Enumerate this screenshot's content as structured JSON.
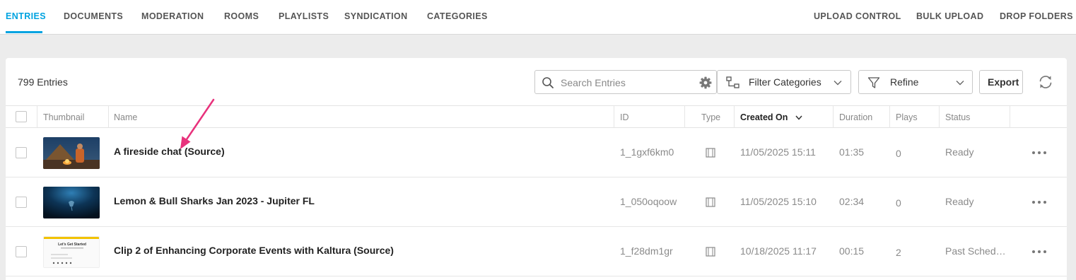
{
  "nav": {
    "tabs_left": [
      "ENTRIES",
      "DOCUMENTS",
      "MODERATION",
      "ROOMS",
      "PLAYLISTS",
      "SYNDICATION",
      "CATEGORIES"
    ],
    "tabs_right": [
      "UPLOAD CONTROL",
      "BULK UPLOAD",
      "DROP FOLDERS"
    ],
    "active_tab": "ENTRIES"
  },
  "toolbar": {
    "entries_count": "799 Entries",
    "search_placeholder": "Search Entries",
    "filter_categories_label": "Filter Categories",
    "refine_label": "Refine",
    "export_label": "Export"
  },
  "table": {
    "columns": [
      "Thumbnail",
      "Name",
      "ID",
      "Type",
      "Created On",
      "Duration",
      "Plays",
      "Status"
    ],
    "sorted_column": "Created On",
    "rows": [
      {
        "name": "A fireside chat (Source)",
        "id": "1_1gxf6km0",
        "type_icon": "video-icon",
        "created_on": "11/05/2025 15:11",
        "duration": "01:35",
        "plays": "0",
        "status": "Ready",
        "thumbnail": "campfire-scene"
      },
      {
        "name": "Lemon & Bull Sharks Jan 2023 - Jupiter FL",
        "id": "1_050oqoow",
        "type_icon": "video-icon",
        "created_on": "11/05/2025 15:10",
        "duration": "02:34",
        "plays": "0",
        "status": "Ready",
        "thumbnail": "underwater-scene"
      },
      {
        "name": "Clip 2 of Enhancing Corporate Events with Kaltura (Source)",
        "id": "1_f28dm1gr",
        "type_icon": "video-icon",
        "created_on": "10/18/2025 11:17",
        "duration": "00:15",
        "plays": "2",
        "status": "Past Sched…",
        "thumbnail": "slide-scene",
        "thumbnail_text": "Let's Get Started"
      }
    ]
  },
  "colors": {
    "accent": "#00a3e0",
    "annotation_arrow": "#e8327c"
  }
}
